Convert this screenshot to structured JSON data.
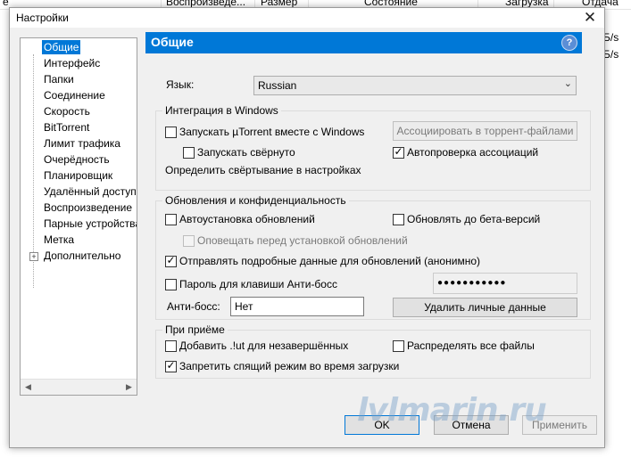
{
  "background_list": {
    "columns": [
      "е",
      "Воспроизведе...",
      "Размер",
      "Состояние",
      "Загрузка",
      "Отдача"
    ],
    "right_cells": [
      "Б/s",
      "Б/s"
    ]
  },
  "dialog": {
    "title": "Настройки",
    "close_glyph": "✕"
  },
  "tree": {
    "items": [
      {
        "label": "Общие",
        "selected": true
      },
      {
        "label": "Интерфейс"
      },
      {
        "label": "Папки"
      },
      {
        "label": "Соединение"
      },
      {
        "label": "Скорость"
      },
      {
        "label": "BitTorrent"
      },
      {
        "label": "Лимит трафика"
      },
      {
        "label": "Очерёдность"
      },
      {
        "label": "Планировщик"
      },
      {
        "label": "Удалённый доступ"
      },
      {
        "label": "Воспроизведение"
      },
      {
        "label": "Парные устройства"
      },
      {
        "label": "Метка"
      },
      {
        "label": "Дополнительно",
        "expander": "+"
      }
    ],
    "scroll_left": "◀",
    "scroll_right": "▶"
  },
  "pane": {
    "title": "Общие",
    "help_glyph": "?",
    "language_label": "Язык:",
    "language_value": "Russian",
    "chevron": "⌄"
  },
  "windows_integration": {
    "title": "Интеграция в Windows",
    "launch_with_windows": {
      "label": "Запускать µTorrent вместе с Windows",
      "checked": false
    },
    "start_minimized": {
      "label": "Запускать свёрнуто",
      "checked": false
    },
    "define_minimize": "Определить свёртывание в настройках",
    "associate_button": "Ассоциировать в торрент-файлами",
    "auto_check_associations": {
      "label": "Автопроверка ассоциаций",
      "checked": true
    }
  },
  "updates_privacy": {
    "title": "Обновления и конфиденциальность",
    "auto_install": {
      "label": "Автоустановка обновлений",
      "checked": false
    },
    "beta_updates": {
      "label": "Обновлять до бета-версий",
      "checked": false
    },
    "notify_before_install": {
      "label": "Оповещать перед установкой обновлений",
      "checked": false
    },
    "send_detailed": {
      "label": "Отправлять подробные данные для обновлений (анонимно)",
      "checked": true
    },
    "boss_key_password": {
      "label": "Пароль для клавиши Анти-босс",
      "checked": false
    },
    "password_value": "●●●●●●●●●●●",
    "anti_boss_label": "Анти-босс:",
    "anti_boss_value": "Нет",
    "delete_personal_button": "Удалить личные данные"
  },
  "on_receive": {
    "title": "При приёме",
    "add_ut_extension": {
      "label": "Добавить .!ut для незавершённых",
      "checked": false
    },
    "distribute_all": {
      "label": "Распределять все файлы",
      "checked": false
    },
    "prevent_standby": {
      "label": "Запретить спящий режим во время загрузки",
      "checked": true
    }
  },
  "footer": {
    "ok": "OK",
    "cancel": "Отмена",
    "apply": "Применить"
  },
  "watermark": "lvlmarin.ru",
  "colors": {
    "accent": "#0078d7",
    "dialog_bg": "#f0f0f0"
  }
}
